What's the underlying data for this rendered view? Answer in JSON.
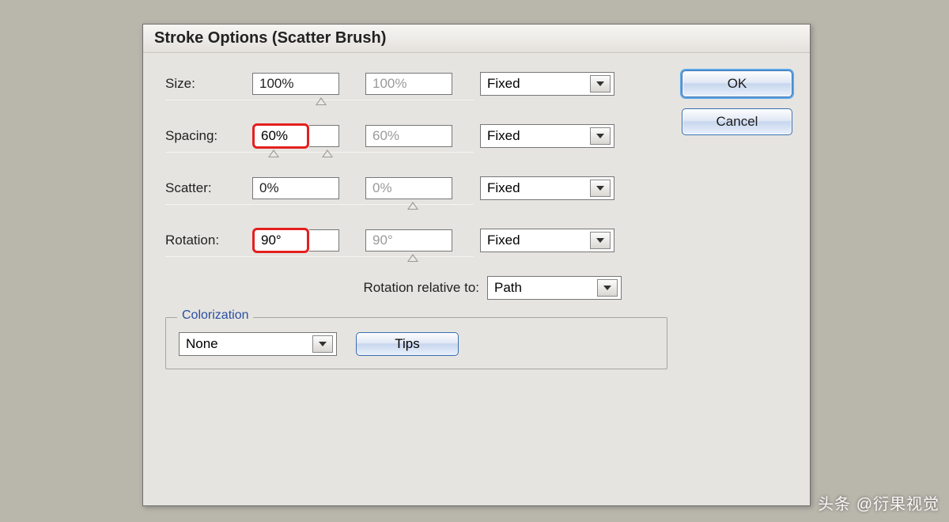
{
  "window": {
    "title": "Stroke Options (Scatter Brush)"
  },
  "buttons": {
    "ok": "OK",
    "cancel": "Cancel",
    "tips": "Tips"
  },
  "rows": {
    "size": {
      "label": "Size:",
      "value1": "100%",
      "value2": "100%",
      "mode": "Fixed",
      "highlighted": false
    },
    "spacing": {
      "label": "Spacing:",
      "value1": "60%",
      "value2": "60%",
      "mode": "Fixed",
      "highlighted": true
    },
    "scatter": {
      "label": "Scatter:",
      "value1": "0%",
      "value2": "0%",
      "mode": "Fixed",
      "highlighted": false
    },
    "rotation": {
      "label": "Rotation:",
      "value1": "90°",
      "value2": "90°",
      "mode": "Fixed",
      "highlighted": true
    }
  },
  "rotationRelative": {
    "label": "Rotation relative to:",
    "value": "Path"
  },
  "colorization": {
    "legend": "Colorization",
    "method": "None"
  },
  "watermark": "头条 @衍果视觉"
}
